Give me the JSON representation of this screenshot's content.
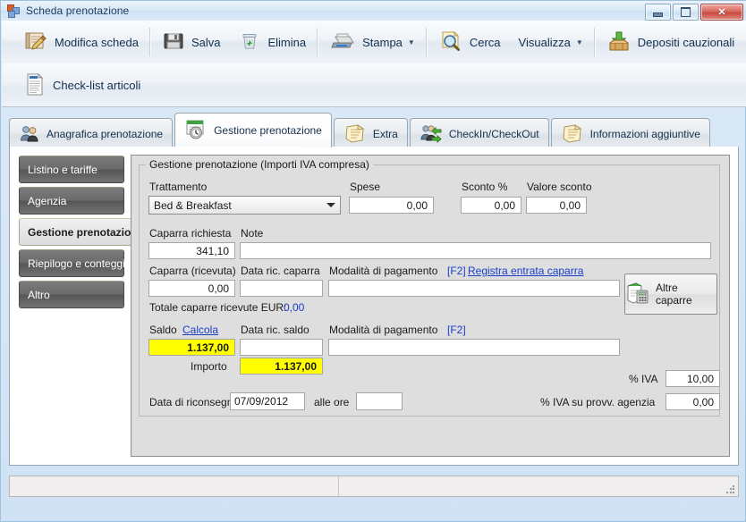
{
  "window": {
    "title": "Scheda prenotazione",
    "icon": "application-icon",
    "buttons": {
      "minimize": "minimize-icon",
      "maximize": "maximize-icon",
      "close": "close-icon"
    }
  },
  "toolbar_primary": [
    {
      "label": "Modifica scheda",
      "icon": "edit-card-icon",
      "dropdown": false
    },
    {
      "label": "Salva",
      "icon": "save-floppy-icon",
      "dropdown": false
    },
    {
      "label": "Elimina",
      "icon": "delete-trash-icon",
      "dropdown": false
    },
    {
      "label": "Stampa",
      "icon": "print-icon",
      "dropdown": true
    },
    {
      "label": "Cerca",
      "icon": "search-magnifier-icon",
      "dropdown": false
    },
    {
      "label": "Visualizza",
      "icon": "view-icon",
      "dropdown": true
    },
    {
      "label": "Depositi cauzionali",
      "icon": "deposit-box-icon",
      "dropdown": false
    }
  ],
  "toolbar_secondary": [
    {
      "label": "Check-list articoli",
      "icon": "checklist-document-icon",
      "dropdown": false
    }
  ],
  "tabs": [
    {
      "label": "Anagrafica prenotazione",
      "icon": "people-icon",
      "active": false
    },
    {
      "label": "Gestione prenotazione",
      "icon": "clock-document-icon",
      "active": true
    },
    {
      "label": "Extra",
      "icon": "notes-icon",
      "active": false
    },
    {
      "label": "CheckIn/CheckOut",
      "icon": "people-arrows-icon",
      "active": false
    },
    {
      "label": "Informazioni aggiuntive",
      "icon": "info-notes-icon",
      "active": false
    }
  ],
  "sidebar": {
    "items": [
      {
        "label": "Listino e tariffe",
        "active": false
      },
      {
        "label": "Agenzia",
        "active": false
      },
      {
        "label": "Gestione prenotazione",
        "active": true
      },
      {
        "label": "Riepilogo e conteggio",
        "active": false
      },
      {
        "label": "Altro",
        "active": false
      }
    ]
  },
  "form": {
    "legend": "Gestione prenotazione (Importi IVA compresa)",
    "trattamento": {
      "label": "Trattamento",
      "value": "Bed & Breakfast"
    },
    "spese": {
      "label": "Spese",
      "value": "0,00"
    },
    "sconto_pct": {
      "label": "Sconto %",
      "value": "0,00"
    },
    "valore_sconto": {
      "label": "Valore sconto",
      "value": "0,00"
    },
    "caparra_richiesta": {
      "label": "Caparra richiesta",
      "value": "341,10"
    },
    "note": {
      "label": "Note",
      "value": ""
    },
    "caparra_ricevuta": {
      "label": "Caparra (ricevuta)",
      "value": "0,00"
    },
    "data_ric_caparra": {
      "label": "Data ric. caparra",
      "value": ""
    },
    "modalita_pagamento_caparra": {
      "label": "Modalità di pagamento",
      "hint": "[F2]",
      "value": ""
    },
    "registra_entrata_caparra": {
      "label": "Registra entrata caparra"
    },
    "altre_caparre": {
      "label": "Altre caparre",
      "icon": "calculator-receipt-icon"
    },
    "totale_caparre": {
      "label": "Totale caparre ricevute EUR:",
      "value": "0,00"
    },
    "saldo": {
      "label": "Saldo",
      "value": "1.137,00"
    },
    "calcola": {
      "label": "Calcola"
    },
    "data_ric_saldo": {
      "label": "Data ric. saldo",
      "value": ""
    },
    "modalita_pagamento_saldo": {
      "label": "Modalità di pagamento",
      "hint": "[F2]",
      "value": ""
    },
    "importo": {
      "label": "Importo",
      "value": "1.137,00"
    },
    "iva_pct": {
      "label": "% IVA",
      "value": "10,00"
    },
    "iva_provv_agenzia": {
      "label": "% IVA su provv. agenzia",
      "value": "0,00"
    },
    "data_riconsegna": {
      "label": "Data di riconsegna",
      "value": "07/09/2012"
    },
    "alle_ore": {
      "label": "alle ore",
      "value": ""
    }
  },
  "statusbar": {
    "left": "",
    "right": ""
  },
  "colors": {
    "highlight_yellow": "#ffff00",
    "link_blue": "#1a3ec8",
    "panel_gray": "#dedede",
    "sidebar_dark": "#6b6b6b",
    "title_blue": "#1c3d63"
  }
}
